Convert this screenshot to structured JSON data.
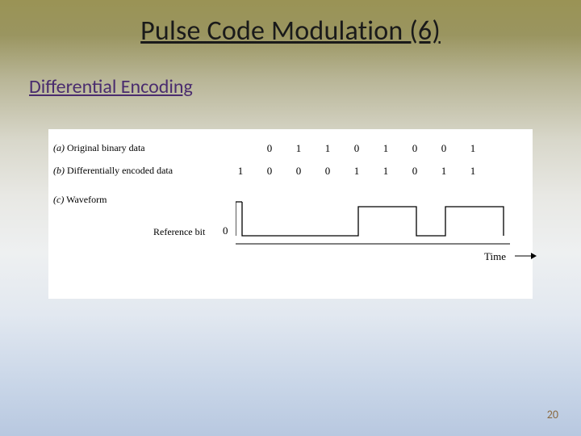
{
  "title": "Pulse Code Modulation (6)",
  "subtitle": "Differential Encoding",
  "figure": {
    "row_a_prefix": "(a)",
    "row_a_label": " Original binary data",
    "row_b_prefix": "(b)",
    "row_b_label": " Differentially encoded data",
    "row_c_prefix": "(c)",
    "row_c_label": " Waveform",
    "reference_bit_label": "Reference bit",
    "reference_zero": "0",
    "bits_a": [
      "0",
      "1",
      "1",
      "0",
      "1",
      "0",
      "0",
      "1"
    ],
    "bits_b": [
      "1",
      "0",
      "0",
      "0",
      "1",
      "1",
      "0",
      "1",
      "1"
    ],
    "time_label": "Time"
  },
  "page_number": "20",
  "chart_data": {
    "type": "line",
    "title": "Differential Encoding",
    "xlabel": "Time",
    "ylabel": "",
    "series": [
      {
        "name": "Original binary data",
        "values": [
          0,
          1,
          1,
          0,
          1,
          0,
          0,
          1
        ]
      },
      {
        "name": "Differentially encoded data",
        "values": [
          1,
          0,
          0,
          0,
          1,
          1,
          0,
          1,
          1
        ]
      }
    ],
    "waveform_levels": [
      0,
      0,
      0,
      0,
      1,
      1,
      0,
      1,
      1
    ],
    "reference_bit": 0
  }
}
